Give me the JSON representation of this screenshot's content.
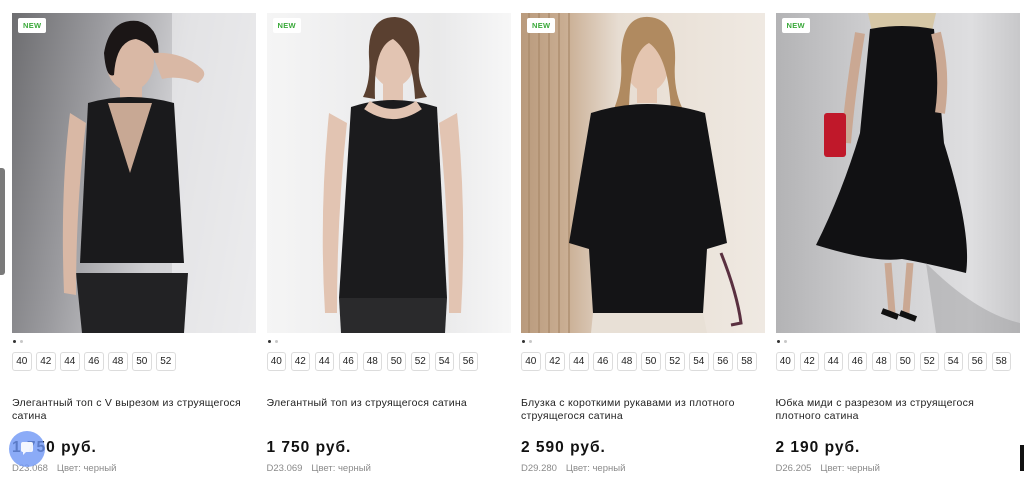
{
  "badge": "NEW",
  "products": [
    {
      "name": "Элегантный топ с V вырезом из струящегося сатина",
      "price": "1 750 руб.",
      "sku": "D23.068",
      "color": "Цвет: черный",
      "sizes": [
        "40",
        "42",
        "44",
        "46",
        "48",
        "50",
        "52"
      ]
    },
    {
      "name": "Элегантный топ из струящегося сатина",
      "price": "1 750 руб.",
      "sku": "D23.069",
      "color": "Цвет: черный",
      "sizes": [
        "40",
        "42",
        "44",
        "46",
        "48",
        "50",
        "52",
        "54",
        "56"
      ]
    },
    {
      "name": "Блузка с короткими рукавами из плотного струящегося сатина",
      "price": "2 590 руб.",
      "sku": "D29.280",
      "color": "Цвет: черный",
      "sizes": [
        "40",
        "42",
        "44",
        "46",
        "48",
        "50",
        "52",
        "54",
        "56",
        "58"
      ]
    },
    {
      "name": "Юбка миди с разрезом из струящегося плотного сатина",
      "price": "2 190 руб.",
      "sku": "D26.205",
      "color": "Цвет: черный",
      "sizes": [
        "40",
        "42",
        "44",
        "46",
        "48",
        "50",
        "52",
        "54",
        "56",
        "58"
      ]
    }
  ]
}
